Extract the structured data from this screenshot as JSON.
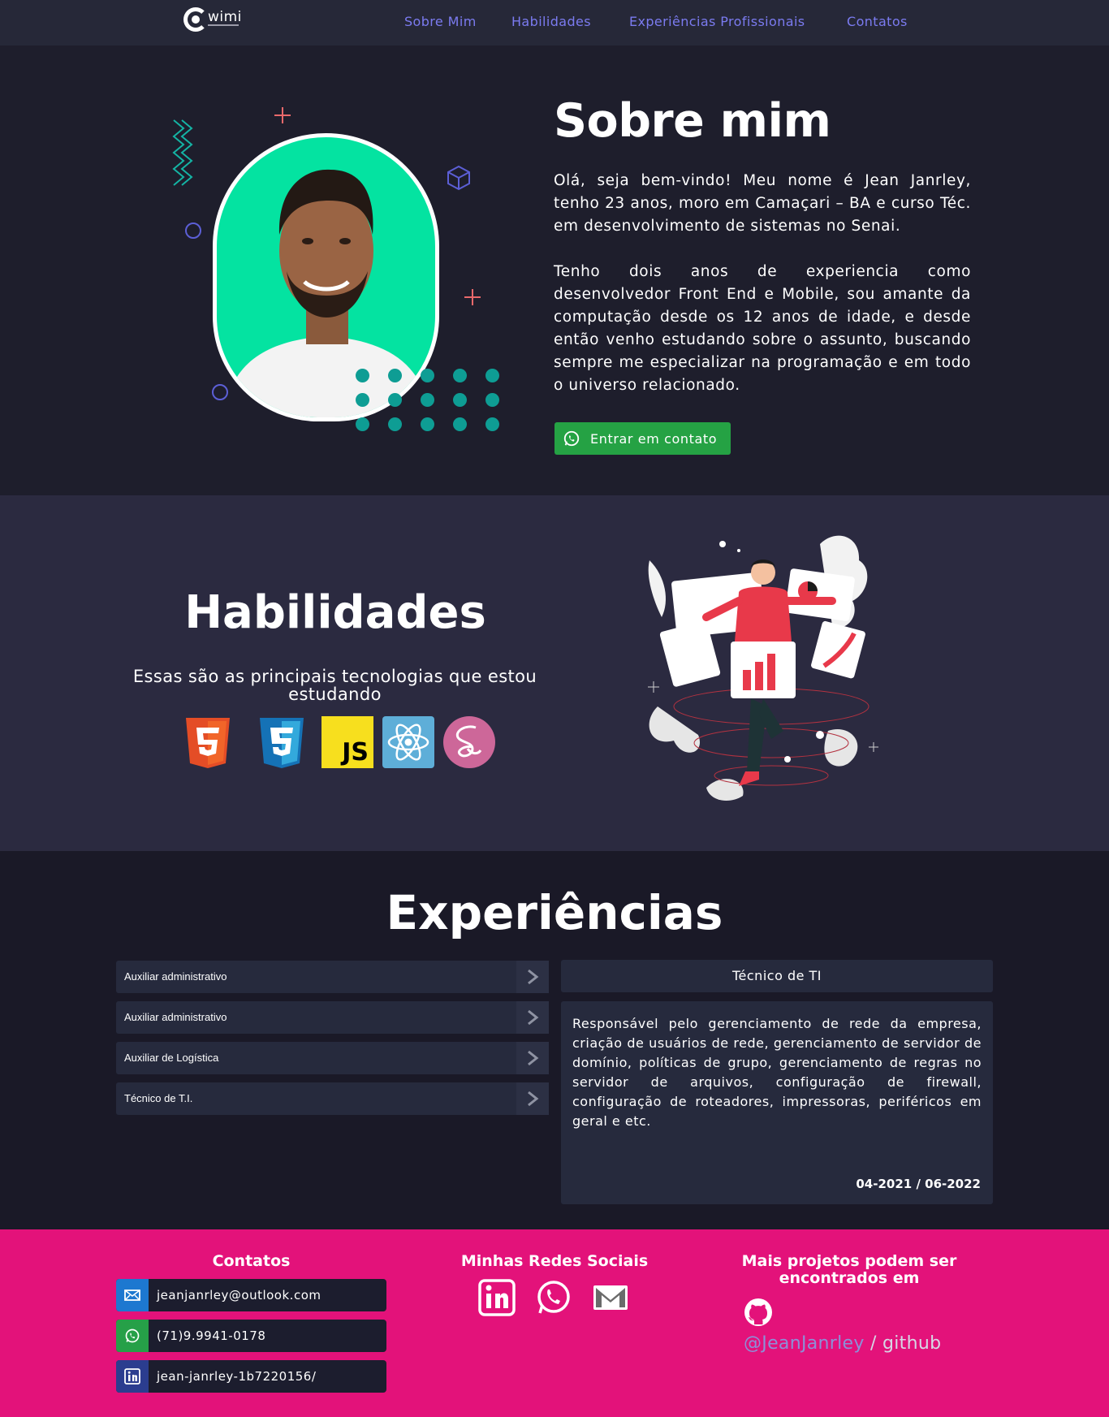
{
  "nav": {
    "logo_text": "wimi",
    "links": [
      "Sobre Mim",
      "Habilidades",
      "Experiências Profissionais",
      "Contatos"
    ]
  },
  "sobre": {
    "title": "Sobre mim",
    "p1": "Olá, seja bem-vindo! Meu nome é Jean Janrley, tenho 23 anos, moro em Camaçari – BA e curso Téc. em desenvolvimento de sistemas no Senai.",
    "p2": "Tenho dois anos de experiencia como desenvolvedor Front End e Mobile, sou amante da computação desde os 12 anos de idade, e desde então venho estudando sobre o assunto, buscando sempre me especializar na programação e em todo o universo relacionado.",
    "button": "Entrar em contato"
  },
  "habilidades": {
    "title": "Habilidades",
    "subtitle": "Essas são as principais tecnologias que estou estudando",
    "tech_icons": [
      "html5-icon",
      "css3-icon",
      "javascript-icon",
      "react-icon",
      "sass-icon"
    ],
    "js_label": "JS"
  },
  "experiencias": {
    "title": "Experiências",
    "jobs": [
      "Auxiliar administrativo",
      "Auxiliar administrativo",
      "Auxiliar de Logística",
      "Técnico de T.I."
    ],
    "detail": {
      "title": "Técnico de TI",
      "description": "Responsável pelo gerenciamento de rede da empresa, criação de usuários de rede, gerenciamento de servidor de domínio, políticas de grupo, gerenciamento de regras no servidor de arquivos, configuração de firewall, configuração de roteadores, impressoras, periféricos em geral e etc.",
      "period": "04-2021 / 06-2022"
    }
  },
  "footer": {
    "contatos_title": "Contatos",
    "contacts": [
      "jeanjanrley@outlook.com",
      "(71)9.9941-0178",
      "jean-janrley-1b7220156/"
    ],
    "redes_title": "Minhas Redes Sociais",
    "projetos_title": "Mais projetos podem ser encontrados em",
    "github_user": "@JeanJanrley",
    "github_sep": " / ",
    "github_label": "github"
  },
  "colors": {
    "nav_bg": "#262838",
    "nav_link": "#7b7bf0",
    "photo_bg": "#04e3a1",
    "whatsapp_green": "#25a244",
    "footer_pink": "#e3127a",
    "dots_teal": "#0e9d94"
  }
}
